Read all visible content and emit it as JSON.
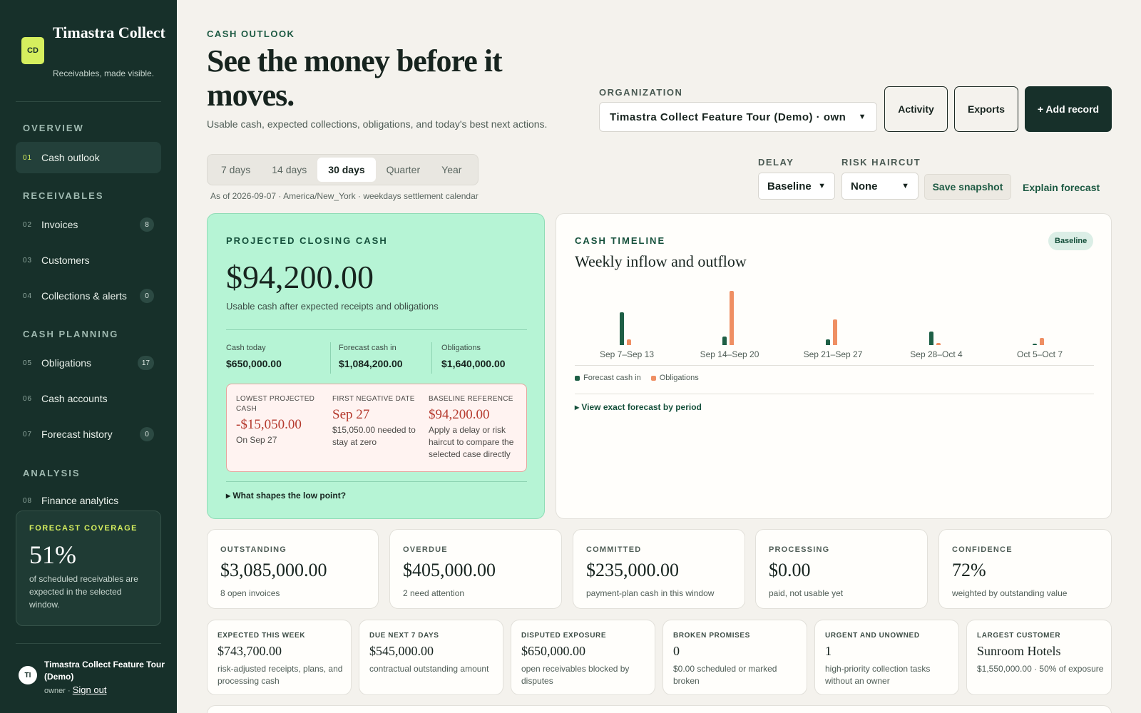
{
  "sidebar": {
    "logo": "CD",
    "brand": "Timastra Collect",
    "tagline": "Receivables, made visible.",
    "sections": [
      "OVERVIEW",
      "RECEIVABLES",
      "CASH PLANNING",
      "ANALYSIS"
    ],
    "items": [
      {
        "num": "01",
        "label": "Cash outlook",
        "badge": ""
      },
      {
        "num": "02",
        "label": "Invoices",
        "badge": "8"
      },
      {
        "num": "03",
        "label": "Customers",
        "badge": ""
      },
      {
        "num": "04",
        "label": "Collections & alerts",
        "badge": "0"
      },
      {
        "num": "05",
        "label": "Obligations",
        "badge": "17"
      },
      {
        "num": "06",
        "label": "Cash accounts",
        "badge": ""
      },
      {
        "num": "07",
        "label": "Forecast history",
        "badge": "0"
      },
      {
        "num": "08",
        "label": "Finance analytics",
        "badge": ""
      }
    ],
    "coverage": {
      "title": "FORECAST COVERAGE",
      "value": "51%",
      "desc": "of scheduled receivables are expected in the selected window."
    },
    "user": {
      "initials": "TI",
      "name": "Timastra Collect Feature Tour (Demo)",
      "role": "owner ·",
      "signout": "Sign out"
    }
  },
  "header": {
    "eyebrow": "CASH OUTLOOK",
    "title": "See the money before it moves.",
    "subtitle": "Usable cash, expected collections, obligations, and today's best next actions.",
    "org_label": "ORGANIZATION",
    "org_value": "Timastra Collect Feature Tour (Demo) · own",
    "activity": "Activity",
    "exports": "Exports",
    "add_record": "+ Add record"
  },
  "controls": {
    "ranges": [
      "7 days",
      "14 days",
      "30 days",
      "Quarter",
      "Year"
    ],
    "active_range": "30 days",
    "as_of": "As of 2026-09-07 · America/New_York · weekdays settlement calendar",
    "delay_label": "DELAY",
    "delay_value": "Baseline",
    "haircut_label": "RISK HAIRCUT",
    "haircut_value": "None",
    "save_snapshot": "Save snapshot",
    "explain": "Explain forecast"
  },
  "projection": {
    "title": "PROJECTED CLOSING CASH",
    "value": "$94,200.00",
    "subtitle": "Usable cash after expected receipts and obligations",
    "cash_today_label": "Cash today",
    "cash_today": "$650,000.00",
    "forecast_in_label": "Forecast cash in",
    "forecast_in": "$1,084,200.00",
    "obligations_label": "Obligations",
    "obligations": "$1,640,000.00",
    "lowest_label": "LOWEST PROJECTED CASH",
    "lowest_value": "-$15,050.00",
    "lowest_sub": "On Sep 27",
    "negative_label": "FIRST NEGATIVE DATE",
    "negative_value": "Sep 27",
    "negative_sub": "$15,050.00 needed to stay at zero",
    "baseline_label": "BASELINE REFERENCE",
    "baseline_value": "$94,200.00",
    "baseline_sub": "Apply a delay or risk haircut to compare the selected case directly",
    "low_point": "▸ What shapes the low point?"
  },
  "timeline": {
    "eyebrow": "CASH TIMELINE",
    "title": "Weekly inflow and outflow",
    "badge": "Baseline",
    "details": "▸ View exact forecast by period"
  },
  "chart_data": {
    "type": "bar",
    "categories": [
      "Sep 7–Sep 13",
      "Sep 14–Sep 20",
      "Sep 21–Sep 27",
      "Sep 28–Oct 4",
      "Oct 5–Oct 7"
    ],
    "series": [
      {
        "name": "Forecast cash in",
        "values": [
          455000,
          120000,
          80000,
          190000,
          20000
        ],
        "color": "#1e5f45"
      },
      {
        "name": "Obligations",
        "values": [
          75000,
          750000,
          360000,
          30000,
          100000
        ],
        "color": "#ef8f63"
      }
    ],
    "ylim": [
      0,
      750000
    ]
  },
  "kpis": [
    {
      "label": "OUTSTANDING",
      "value": "$3,085,000.00",
      "sub": "8 open invoices"
    },
    {
      "label": "OVERDUE",
      "value": "$405,000.00",
      "sub": "2 need attention"
    },
    {
      "label": "COMMITTED",
      "value": "$235,000.00",
      "sub": "payment-plan cash in this window"
    },
    {
      "label": "PROCESSING",
      "value": "$0.00",
      "sub": "paid, not usable yet"
    },
    {
      "label": "CONFIDENCE",
      "value": "72%",
      "sub": "weighted by outstanding value"
    }
  ],
  "stats": [
    {
      "label": "EXPECTED THIS WEEK",
      "value": "$743,700.00",
      "sub": "risk-adjusted receipts, plans, and processing cash"
    },
    {
      "label": "DUE NEXT 7 DAYS",
      "value": "$545,000.00",
      "sub": "contractual outstanding amount"
    },
    {
      "label": "DISPUTED EXPOSURE",
      "value": "$650,000.00",
      "sub": "open receivables blocked by disputes"
    },
    {
      "label": "BROKEN PROMISES",
      "value": "0",
      "sub": "$0.00 scheduled or marked broken"
    },
    {
      "label": "URGENT AND UNOWNED",
      "value": "1",
      "sub": "high-priority collection tasks without an owner"
    },
    {
      "label": "LARGEST CUSTOMER",
      "value": "Sunroom Hotels",
      "sub": "$1,550,000.00 · 50% of exposure"
    }
  ]
}
